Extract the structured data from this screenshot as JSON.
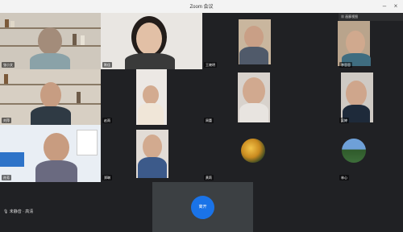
{
  "window": {
    "title": "Zoom 会议"
  },
  "participants": [
    {
      "name": "张小文"
    },
    {
      "name": "陈佳"
    },
    {
      "name": "王晓明"
    },
    {
      "name": "李思思"
    },
    {
      "name": "刘萍"
    },
    {
      "name": "赵雨"
    },
    {
      "name": "周蕾"
    },
    {
      "name": "吴婷"
    },
    {
      "name": "孙芳"
    },
    {
      "name": "郑琳"
    },
    {
      "name": "黄莉"
    },
    {
      "name": "林心"
    }
  ],
  "header": {
    "view_label": "画廊视图"
  },
  "status": {
    "text": "未静音 · 高清"
  },
  "controls": {
    "leave_label": "离开"
  },
  "colors": {
    "speaking": "#34a853",
    "leave_button": "#1a73e8"
  }
}
